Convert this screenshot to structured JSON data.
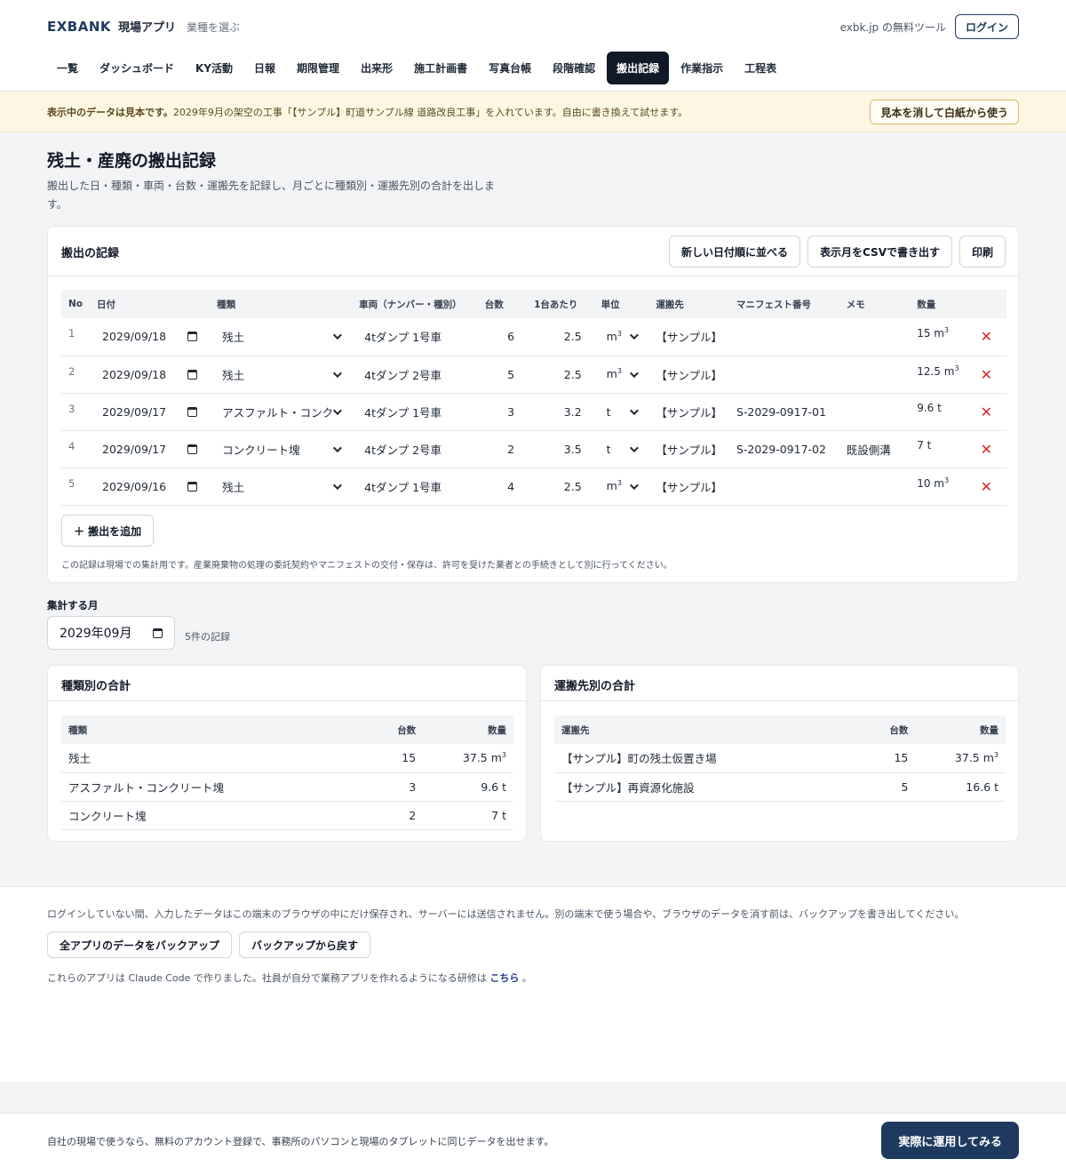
{
  "header": {
    "logo": "EXBANK",
    "app_name": "現場アプリ",
    "choose_industry": "業種を選ぶ",
    "free_tool": "exbk.jp の無料ツール",
    "login": "ログイン"
  },
  "nav": {
    "tabs": [
      {
        "label": "一覧",
        "active": false
      },
      {
        "label": "ダッシュボード",
        "active": false
      },
      {
        "label": "KY活動",
        "active": false
      },
      {
        "label": "日報",
        "active": false
      },
      {
        "label": "期限管理",
        "active": false
      },
      {
        "label": "出来形",
        "active": false
      },
      {
        "label": "施工計画書",
        "active": false
      },
      {
        "label": "写真台帳",
        "active": false
      },
      {
        "label": "段階確認",
        "active": false
      },
      {
        "label": "搬出記録",
        "active": true
      },
      {
        "label": "作業指示",
        "active": false
      },
      {
        "label": "工程表",
        "active": false
      }
    ]
  },
  "banner": {
    "bold": "表示中のデータは見本です。",
    "text": "2029年9月の架空の工事「【サンプル】町道サンプル線 道路改良工事」を入れています。自由に書き換えて試せます。",
    "clear_button": "見本を消して白紙から使う"
  },
  "page": {
    "title": "残土・産廃の搬出記録",
    "description": "搬出した日・種類・車両・台数・運搬先を記録し、月ごとに種類別・運搬先別の合計を出します。"
  },
  "records": {
    "title": "搬出の記録",
    "sort_button": "新しい日付順に並べる",
    "csv_button": "表示月をCSVで書き出す",
    "print_button": "印刷",
    "columns": [
      "No",
      "日付",
      "種類",
      "車両（ナンバー・種別）",
      "台数",
      "1台あたり",
      "単位",
      "運搬先",
      "マニフェスト番号",
      "メモ",
      "数量"
    ],
    "rows": [
      {
        "no": "1",
        "date": "2029/09/18",
        "type": "残土",
        "vehicle": "4tダンプ 1号車",
        "count": "6",
        "per": "2.5",
        "unit": "m³",
        "dest": "【サンプル】",
        "manifest": "",
        "memo": "",
        "qty": "15 m³"
      },
      {
        "no": "2",
        "date": "2029/09/18",
        "type": "残土",
        "vehicle": "4tダンプ 2号車",
        "count": "5",
        "per": "2.5",
        "unit": "m³",
        "dest": "【サンプル】",
        "manifest": "",
        "memo": "",
        "qty": "12.5 m³"
      },
      {
        "no": "3",
        "date": "2029/09/17",
        "type": "アスファルト・コンク!",
        "vehicle": "4tダンプ 1号車",
        "count": "3",
        "per": "3.2",
        "unit": "t",
        "dest": "【サンプル】",
        "manifest": "S-2029-0917-01",
        "memo": "",
        "qty": "9.6 t"
      },
      {
        "no": "4",
        "date": "2029/09/17",
        "type": "コンクリート塊",
        "vehicle": "4tダンプ 2号車",
        "count": "2",
        "per": "3.5",
        "unit": "t",
        "dest": "【サンプル】",
        "manifest": "S-2029-0917-02",
        "memo": "既設側溝",
        "qty": "7 t"
      },
      {
        "no": "5",
        "date": "2029/09/16",
        "type": "残土",
        "vehicle": "4tダンプ 1号車",
        "count": "4",
        "per": "2.5",
        "unit": "m³",
        "dest": "【サンプル】",
        "manifest": "",
        "memo": "",
        "qty": "10 m³"
      }
    ],
    "add_button": "＋ 搬出を追加",
    "note": "この記録は現場での集計用です。産業廃棄物の処理の委託契約やマニフェストの交付・保存は、許可を受けた業者との手続きとして別に行ってください。"
  },
  "month": {
    "label": "集計する月",
    "value": "2029年09月",
    "count": "5件の記録"
  },
  "by_type": {
    "title": "種類別の合計",
    "columns": [
      "種類",
      "台数",
      "数量"
    ],
    "rows": [
      {
        "name": "残土",
        "count": "15",
        "qty": "37.5 m³"
      },
      {
        "name": "アスファルト・コンクリート塊",
        "count": "3",
        "qty": "9.6 t"
      },
      {
        "name": "コンクリート塊",
        "count": "2",
        "qty": "7 t"
      }
    ]
  },
  "by_dest": {
    "title": "運搬先別の合計",
    "columns": [
      "運搬先",
      "台数",
      "数量"
    ],
    "rows": [
      {
        "name": "【サンプル】町の残土仮置き場",
        "count": "15",
        "qty": "37.5 m³"
      },
      {
        "name": "【サンプル】再資源化施設",
        "count": "5",
        "qty": "16.6 t"
      }
    ]
  },
  "footer": {
    "storage_note": "ログインしていない間、入力したデータはこの端末のブラウザの中にだけ保存され、サーバーには送信されません。別の端末で使う場合や、ブラウザのデータを消す前は、バックアップを書き出してください。",
    "backup_button": "全アプリのデータをバックアップ",
    "restore_button": "バックアップから戻す",
    "made_with": "これらのアプリは Claude Code で作りました。社員が自分で業務アプリを作れるようになる研修は",
    "link": "こちら",
    "period": "。"
  },
  "bottom": {
    "text": "自社の現場で使うなら、無料のアカウント登録で、事務所のパソコンと現場のタブレットに同じデータを出せます。",
    "cta": "実際に運用してみる"
  }
}
